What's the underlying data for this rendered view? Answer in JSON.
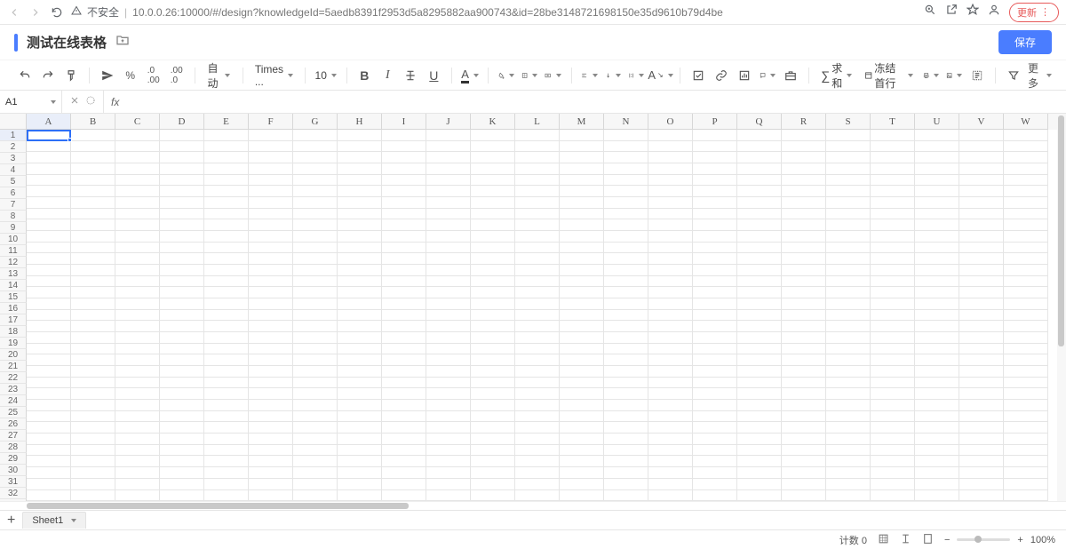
{
  "browser": {
    "notSecure": "不安全",
    "url": "10.0.0.26:10000/#/design?knowledgeId=5aedb8391f2953d5a8295882aa900743&id=28be3148721698150e35d9610b79d4be",
    "updateLabel": "更新"
  },
  "header": {
    "title": "测试在线表格",
    "saveLabel": "保存"
  },
  "toolbar": {
    "format": "自动",
    "font": "Times ...",
    "size": "10",
    "sumLabel": "求和",
    "freezeLabel": "冻结首行",
    "moreLabel": "更多"
  },
  "formula": {
    "nameBox": "A1",
    "fx": "fx",
    "value": ""
  },
  "columns": [
    "A",
    "B",
    "C",
    "D",
    "E",
    "F",
    "G",
    "H",
    "I",
    "J",
    "K",
    "L",
    "M",
    "N",
    "O",
    "P",
    "Q",
    "R",
    "S",
    "T",
    "U",
    "V",
    "W"
  ],
  "rows": 33,
  "sheets": {
    "tab1": "Sheet1"
  },
  "status": {
    "countLabel": "计数",
    "countValue": "0",
    "zoom": "100%"
  }
}
